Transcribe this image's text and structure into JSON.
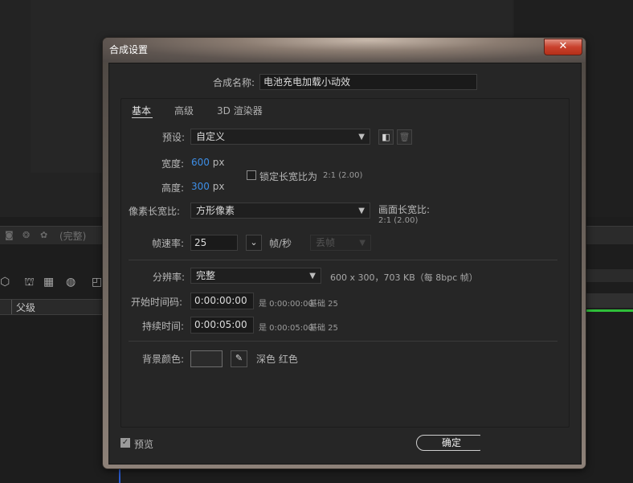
{
  "background": {
    "status_text": "(完整)",
    "layer_header": "父级"
  },
  "dialog": {
    "title": "合成设置",
    "close_label": "✕",
    "comp_name_label": "合成名称:",
    "comp_name_value": "电池充电加载小动效",
    "tabs": [
      "基本",
      "高级",
      "3D 渲染器"
    ],
    "preset": {
      "label": "预设:",
      "value": "自定义"
    },
    "width": {
      "label": "宽度:",
      "value": "600",
      "unit": "px"
    },
    "height": {
      "label": "高度:",
      "value": "300",
      "unit": "px"
    },
    "lock_aspect": {
      "label": "锁定长宽比为",
      "ratio": "2:1 (2.00)",
      "checked": false
    },
    "pixel_aspect": {
      "label": "像素长宽比:",
      "value": "方形像素"
    },
    "frame_aspect": {
      "label": "画面长宽比:",
      "value": "2:1 (2.00)"
    },
    "frame_rate": {
      "label": "帧速率:",
      "value": "25",
      "unit": "帧/秒",
      "drop_frame": "丢帧"
    },
    "resolution": {
      "label": "分辨率:",
      "value": "完整",
      "info": "600 x 300，703 KB（每 8bpc 帧）"
    },
    "start_timecode": {
      "label": "开始时间码:",
      "value": "0:00:00:00",
      "equals": "是 0:00:00:00",
      "base": "基础 25"
    },
    "duration": {
      "label": "持续时间:",
      "value": "0:00:05:00",
      "equals": "是 0:00:05:00",
      "base": "基础 25"
    },
    "bg_color": {
      "label": "背景颜色:",
      "name": "深色 红色",
      "swatch": "#2b2b2b"
    },
    "preview": {
      "label": "预览",
      "checked": true
    },
    "ok_label": "确定"
  },
  "colors": {
    "accent_value": "#3d8ee6",
    "timeline_green": "#2fbf3a"
  }
}
